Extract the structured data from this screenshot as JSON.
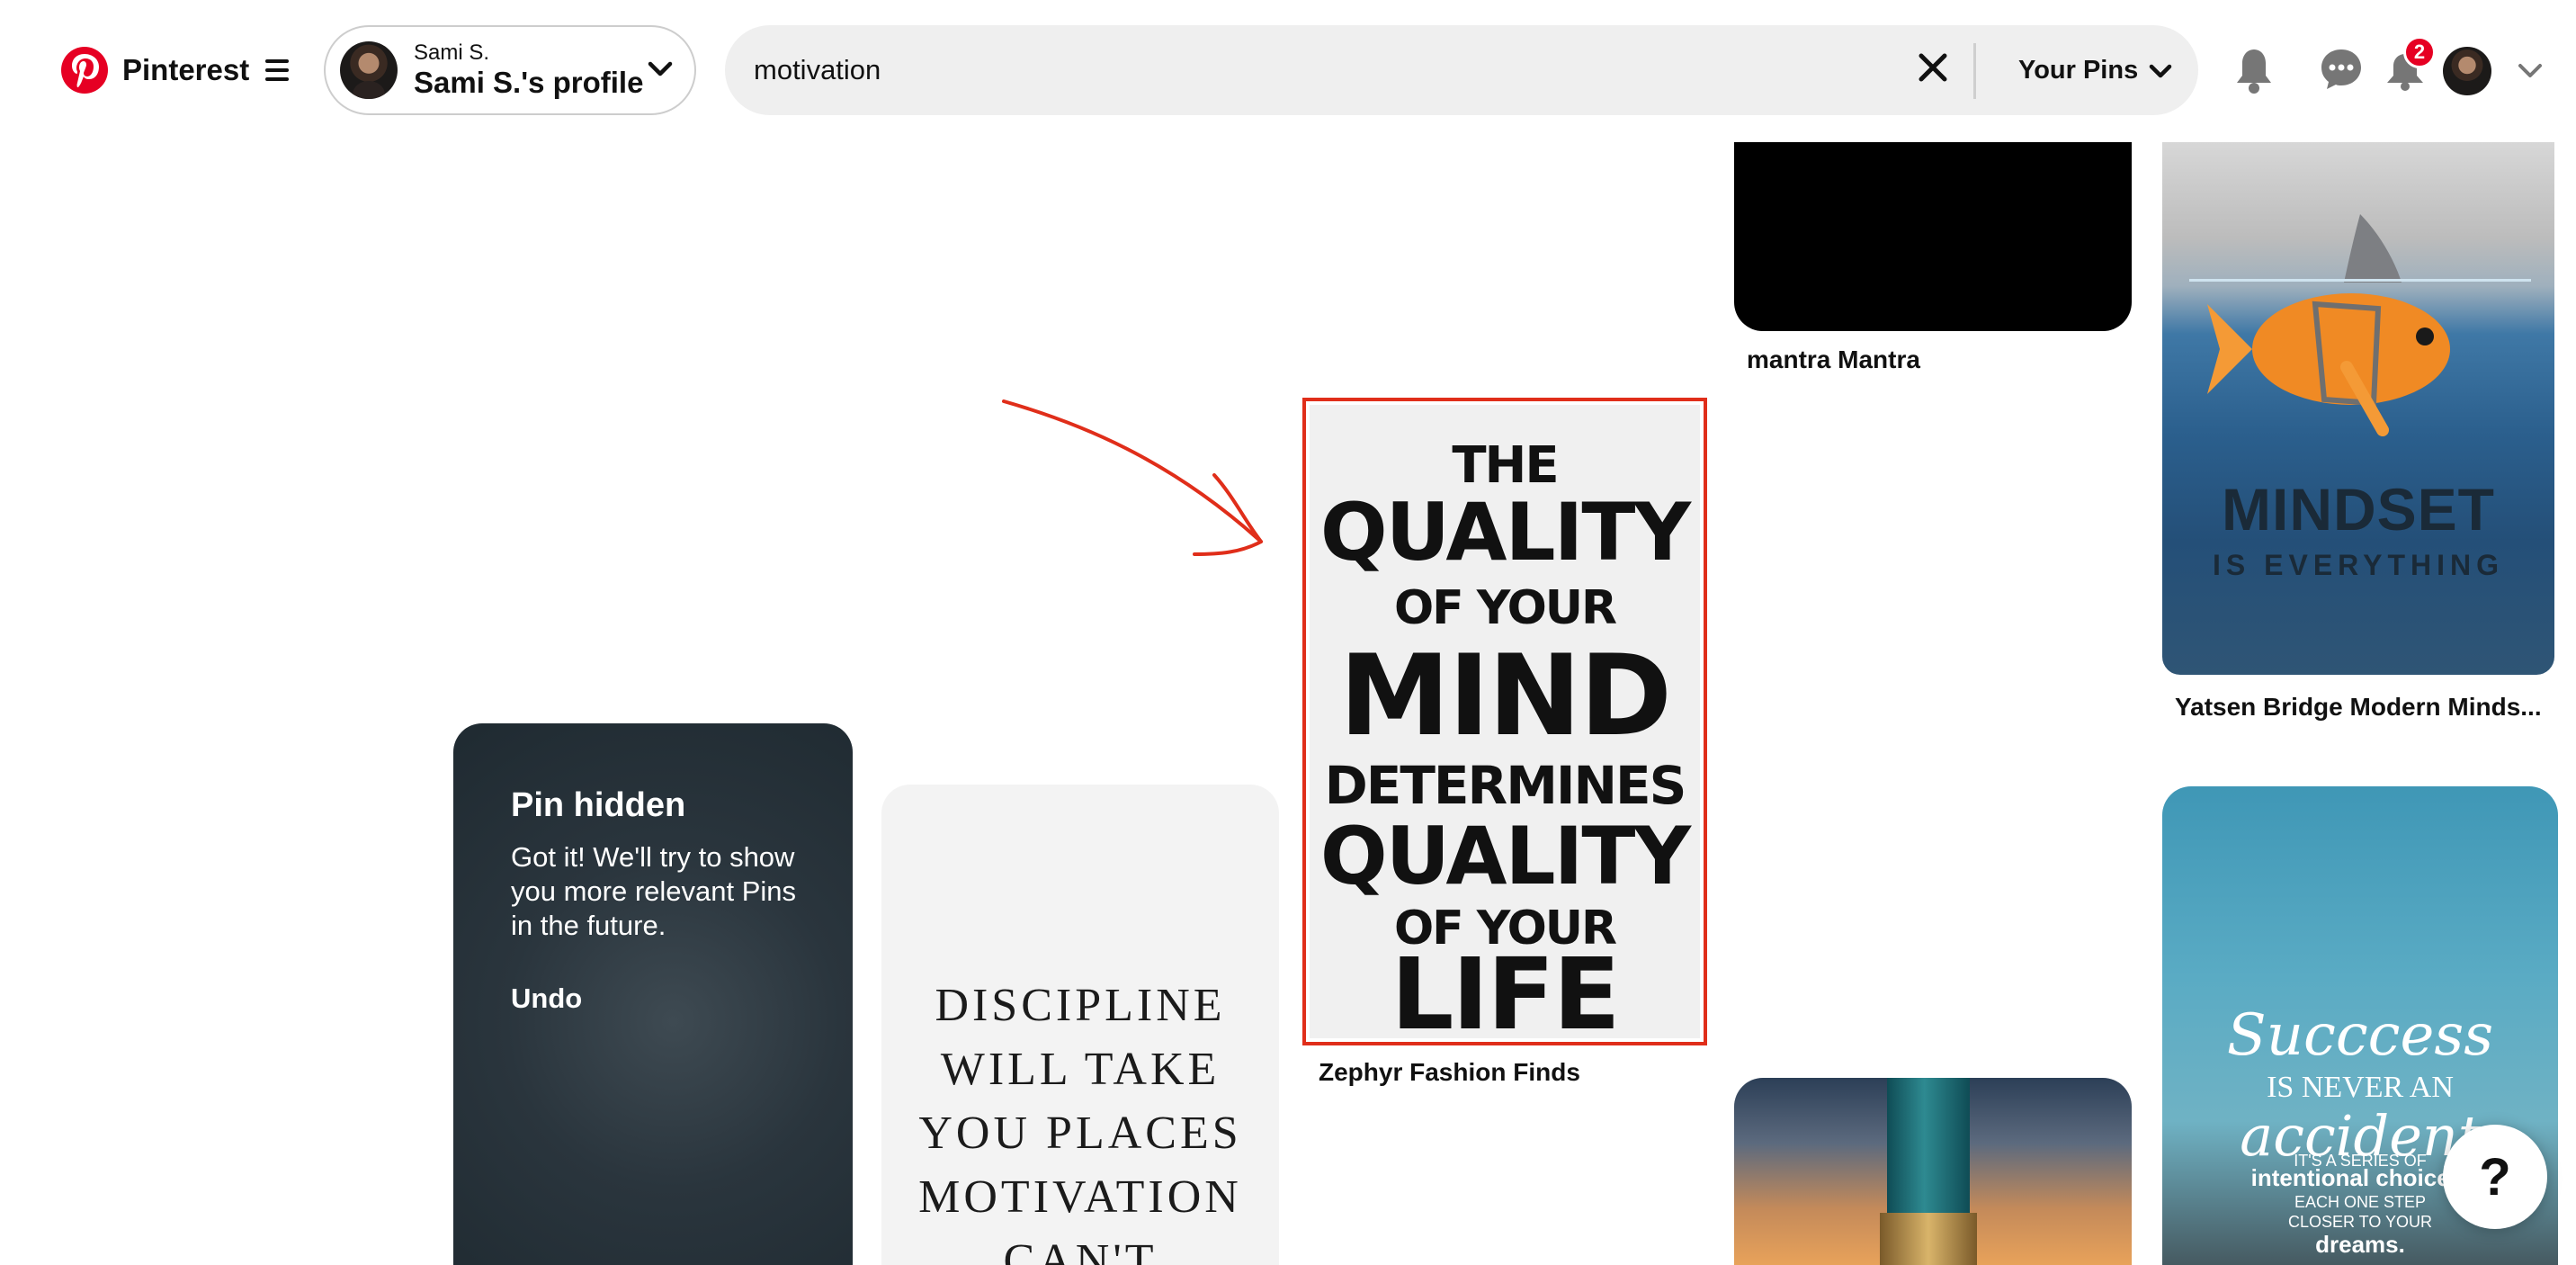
{
  "header": {
    "brand": "Pinterest",
    "profile": {
      "name_small": "Sami S.",
      "name_big": "Sami S.'s profile"
    },
    "search": {
      "value": "motivation",
      "scope_label": "Your Pins"
    },
    "updates_badge": "2"
  },
  "pins": {
    "black": {
      "title": "mantra Mantra"
    },
    "mindset": {
      "title": "Yatsen Bridge Modern Minds...",
      "headline": "MINDSET",
      "subline": "IS EVERYTHING"
    },
    "hidden": {
      "title": "Pin hidden",
      "body": "Got it! We'll try to show you more relevant Pins in the future.",
      "undo": "Undo"
    },
    "discipline": {
      "text": "DISCIPLINE\nWILL TAKE\nYOU PLACES\nMOTIVATION\nCAN'T"
    },
    "quality": {
      "title": "Zephyr Fashion Finds",
      "lines": [
        "THE",
        "QUALITY",
        "OF YOUR",
        "MIND",
        "DETERMINES",
        "QUALITY",
        "OF YOUR",
        "LIFE"
      ]
    },
    "success": {
      "line1": "Succcess",
      "line2": "IS NEVER AN",
      "line3": "accident",
      "line4": "IT'S A SERIES OF",
      "line5": "intentional choices,",
      "line6": "EACH ONE STEP",
      "line7": "CLOSER TO YOUR",
      "line8": "dreams."
    }
  },
  "help_label": "?",
  "colors": {
    "brand": "#e60023",
    "highlight": "#e02e1a",
    "search_bg": "#efefef"
  }
}
